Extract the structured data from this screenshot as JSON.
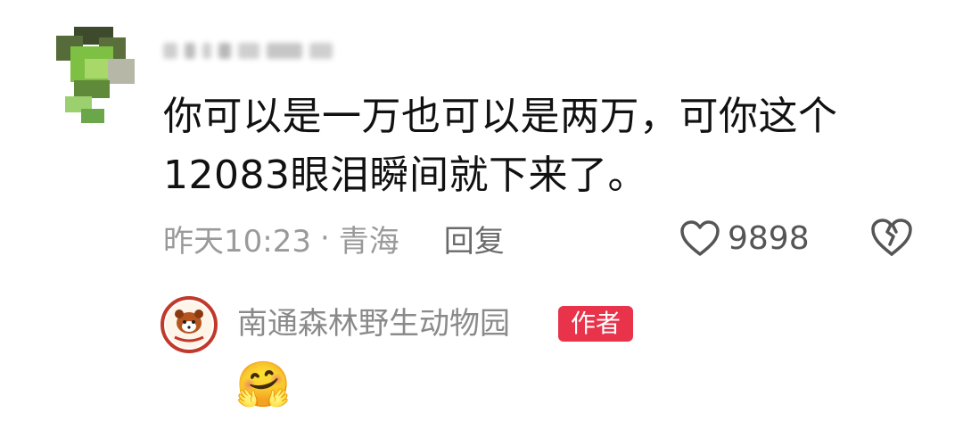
{
  "comment": {
    "username": "· · · · ·",
    "text_line1": "你可以是一万也可以是两万，可你这个",
    "text_line2": "12083眼泪瞬间就下来了。",
    "timestamp": "昨天10:23",
    "separator": "·",
    "location": "青海",
    "reply_label": "回复",
    "like_count": "9898",
    "colors": {
      "text": "#111111",
      "meta": "#9a9a9a"
    }
  },
  "reply": {
    "author_name": "南通森林野生动物园",
    "badge_label": "作者",
    "emoji": "🤗",
    "badge_color": "#e8334b",
    "avatar_icon": "red-panda-logo-icon"
  }
}
